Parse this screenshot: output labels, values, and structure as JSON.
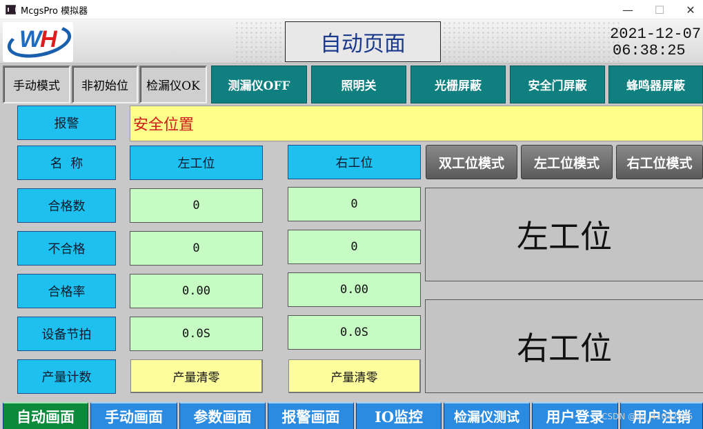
{
  "window": {
    "title": "McgsPro 模拟器",
    "min_glyph": "—",
    "max_glyph": "☐",
    "close_glyph": "✕"
  },
  "header": {
    "logo_text": "WH",
    "title": "自动页面",
    "date": "2021-12-07",
    "time": "06:38:25"
  },
  "status_indicators": [
    "手动模式",
    "非初始位",
    "检漏仪OK"
  ],
  "toggle_buttons": [
    "测漏仪OFF",
    "照明关",
    "光栅屏蔽",
    "安全门屏蔽",
    "蜂鸣器屏蔽"
  ],
  "alarm": {
    "label": "报警",
    "message": "安全位置"
  },
  "table": {
    "name_label": "名  称",
    "left_header": "左工位",
    "right_header": "右工位",
    "rows": [
      {
        "label": "合格数",
        "left": "0",
        "right": "0"
      },
      {
        "label": "不合格",
        "left": "0",
        "right": "0"
      },
      {
        "label": "合格率",
        "left": "0.00",
        "right": "0.00"
      },
      {
        "label": "设备节拍",
        "left": "0.0S",
        "right": "0.0S"
      }
    ],
    "reset_label": "产量计数",
    "left_reset": "产量清零",
    "right_reset": "产量清零"
  },
  "mode_buttons": [
    "双工位模式",
    "左工位模式",
    "右工位模式"
  ],
  "station_panels": [
    "左工位",
    "右工位"
  ],
  "nav": {
    "active_index": 0,
    "items": [
      "自动画面",
      "手动画面",
      "参数画面",
      "报警画面",
      "IO监控",
      "检漏仪测试",
      "用户登录",
      "用户注销"
    ]
  },
  "watermark": "CSDN @qq_41042595",
  "colors": {
    "teal": "#0f7f80",
    "cyan": "#1ec0f0",
    "green": "#c6fbc4",
    "yellow": "#fdfd8a",
    "nav_blue": "#2a8be0",
    "nav_active": "#0c8a3c",
    "alarm_text": "#d01b1b"
  }
}
